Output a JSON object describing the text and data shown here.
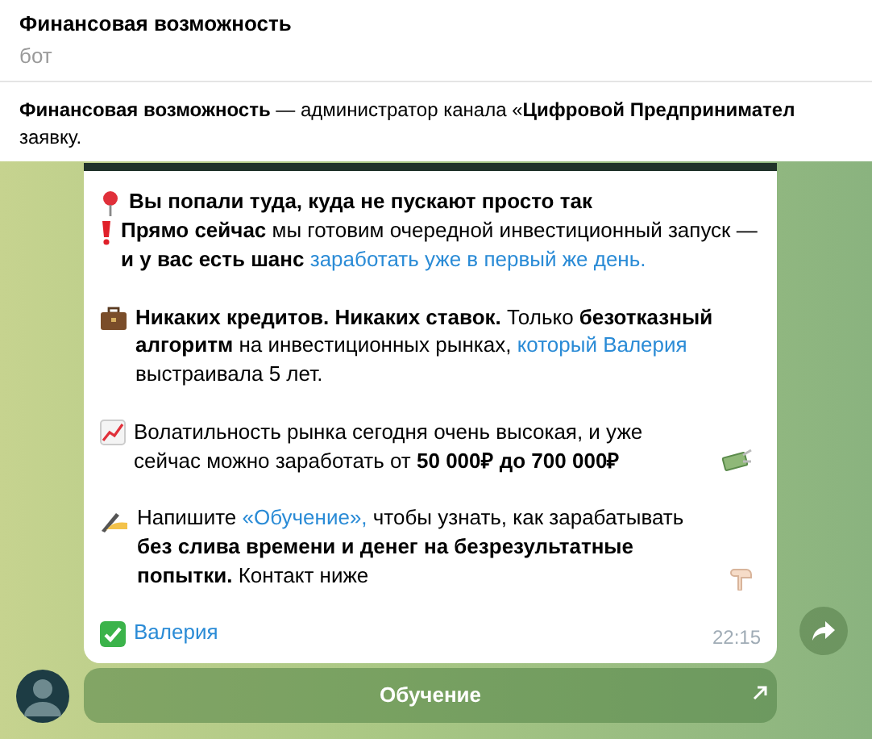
{
  "header": {
    "title": "Финансовая возможность",
    "subtitle": "бот"
  },
  "notice": {
    "lines": [
      "**Финансовая возможность** — администратор канала «**Цифровой Предпринимател**",
      "заявку."
    ]
  },
  "message": {
    "paragraphs": [
      [
        [
          {
            "kind": "bold",
            "text": "Вы попали туда, куда не пускают просто так"
          }
        ],
        [
          {
            "kind": "bold",
            "text": "Прямо сейчас"
          },
          {
            "kind": "plain",
            "text": " мы готовим очередной инвестиционный запуск — "
          },
          {
            "kind": "bold",
            "text": "и у вас есть шанс "
          },
          {
            "kind": "link",
            "text": "заработать уже в первый же день."
          }
        ]
      ],
      [
        [
          {
            "kind": "bold",
            "text": "Никаких кредитов. Никаких ставок."
          },
          {
            "kind": "plain",
            "text": " Только "
          },
          {
            "kind": "bold",
            "text": "безотказный алгоритм"
          },
          {
            "kind": "plain",
            "text": " на инвестиционных рынках, "
          },
          {
            "kind": "link",
            "text": "который Валерия"
          },
          {
            "kind": "plain",
            "text": " выстраивала 5 лет."
          }
        ]
      ],
      [
        [
          {
            "kind": "plain",
            "text": "Волатильность рынка сегодня очень высокая, и уже сейчас можно заработать от "
          },
          {
            "kind": "bold",
            "text": "50  000₽ до 700 000₽"
          }
        ]
      ],
      [
        [
          {
            "kind": "plain",
            "text": "Напишите "
          },
          {
            "kind": "link",
            "text": "«Обучение»,"
          },
          {
            "kind": "plain",
            "text": " чтобы узнать, как зарабатывать "
          },
          {
            "kind": "bold",
            "text": "без слива времени и денег на безрезультатные попытки."
          },
          {
            "kind": "plain",
            "text": " Контакт ниже"
          }
        ]
      ],
      [
        [
          {
            "kind": "link",
            "text": "Валерия"
          }
        ]
      ]
    ],
    "time": "22:15"
  },
  "inline_button": {
    "label": "Обучение"
  }
}
